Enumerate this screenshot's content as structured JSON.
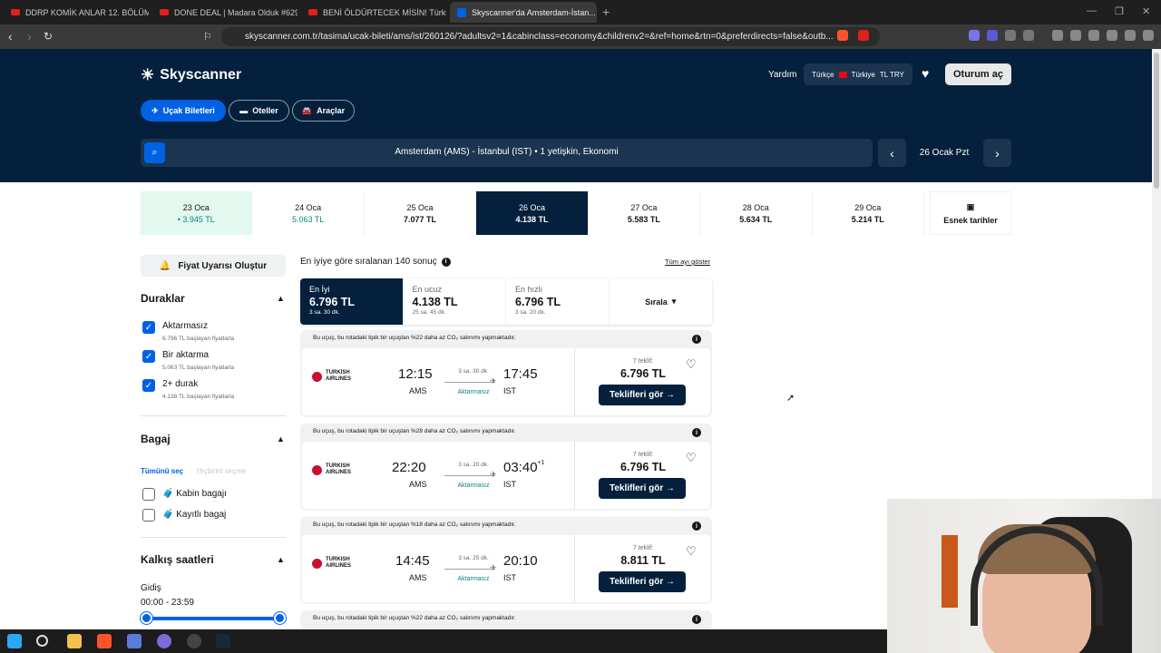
{
  "browser": {
    "tabs": [
      {
        "title": "DDRP KOMİK ANLAR 12. BÖLÜM VE..."
      },
      {
        "title": "DONE DEAL | Madara Olduk #629 - Y..."
      },
      {
        "title": "BENİ ÖLDÜRTECEK MİSİN! Türkiye'd..."
      },
      {
        "title": "Skyscanner'da Amsterdam-İstan..."
      }
    ],
    "url": "skyscanner.com.tr/tasima/ucak-bileti/ams/ist/260126/?adultsv2=1&cabinclass=economy&childrenv2=&ref=home&rtn=0&preferdirects=false&outb..."
  },
  "header": {
    "brand": "Skyscanner",
    "help": "Yardım",
    "locale": {
      "language": "Türkçe",
      "country": "Türkiye",
      "currency": "TL TRY"
    },
    "login": "Oturum aç",
    "categories": [
      {
        "label": "Uçak Biletleri",
        "icon": "plane-icon"
      },
      {
        "label": "Oteller",
        "icon": "bed-icon"
      },
      {
        "label": "Araçlar",
        "icon": "car-icon"
      }
    ],
    "search_summary": "Amsterdam (AMS) - İstanbul (IST)  •  1 yetişkin, Ekonomi",
    "selected_date": "26 Ocak Pzt"
  },
  "date_strip": [
    {
      "date": "23 Oca",
      "price": "• 3.945 TL",
      "state": "cheap"
    },
    {
      "date": "24 Oca",
      "price": "5.063 TL",
      "state": "green"
    },
    {
      "date": "25 Oca",
      "price": "7.077 TL",
      "state": "normal"
    },
    {
      "date": "26 Oca",
      "price": "4.138 TL",
      "state": "selected"
    },
    {
      "date": "27 Oca",
      "price": "5.583 TL",
      "state": "normal"
    },
    {
      "date": "28 Oca",
      "price": "5.634 TL",
      "state": "normal"
    },
    {
      "date": "29 Oca",
      "price": "5.214 TL",
      "state": "normal"
    }
  ],
  "flex_dates": "Esnek tarihler",
  "filters": {
    "price_alert": "Fiyat Uyarısı Oluştur",
    "stops_title": "Duraklar",
    "stops": [
      {
        "label": "Aktarmasız",
        "sub": "6.796 TL başlayan fiyatlarla"
      },
      {
        "label": "Bir aktarma",
        "sub": "5.063 TL başlayan fiyatlarla"
      },
      {
        "label": "2+ durak",
        "sub": "4.138 TL başlayan fiyatlarla"
      }
    ],
    "baggage_title": "Bagaj",
    "select_all": "Tümünü seç",
    "select_none": "Hiçbirini seçme",
    "baggage": [
      {
        "label": "Kabin bagajı"
      },
      {
        "label": "Kayıtlı bagaj"
      }
    ],
    "departure_title": "Kalkış saatleri",
    "outbound_label": "Gidiş",
    "outbound_range": "00:00 - 23:59"
  },
  "results": {
    "count_text": "En iyiye göre sıralanan 140 sonuç",
    "show_month": "Tüm ayı göster",
    "sort_tabs": [
      {
        "label": "En İyi",
        "price": "6.796 TL",
        "duration": "3 sa. 30 dk."
      },
      {
        "label": "En ucuz",
        "price": "4.138 TL",
        "duration": "25 sa. 45 dk."
      },
      {
        "label": "En hızlı",
        "price": "6.796 TL",
        "duration": "3 sa. 20 dk."
      }
    ],
    "sort_label": "Sırala",
    "flights": [
      {
        "eco_note": "Bu uçuş, bu rotadaki tipik bir uçuştan %22 daha az CO₂ salınımı yapmaktadır.",
        "airline": "TURKISH AIRLINES",
        "dep_time": "12:15",
        "dep_code": "AMS",
        "arr_time": "17:45",
        "arr_plus": "",
        "arr_code": "IST",
        "duration": "3 sa. 30 dk.",
        "stops": "Aktarmasız",
        "offers": "7 teklif:",
        "price": "6.796 TL",
        "cta": "Teklifleri gör →"
      },
      {
        "eco_note": "Bu uçuş, bu rotadaki tipik bir uçuştan %28 daha az CO₂ salınımı yapmaktadır.",
        "airline": "TURKISH AIRLINES",
        "dep_time": "22:20",
        "dep_code": "AMS",
        "arr_time": "03:40",
        "arr_plus": "+1",
        "arr_code": "IST",
        "duration": "3 sa. 20 dk.",
        "stops": "Aktarmasız",
        "offers": "7 teklif:",
        "price": "6.796 TL",
        "cta": "Teklifleri gör →"
      },
      {
        "eco_note": "Bu uçuş, bu rotadaki tipik bir uçuştan %18 daha az CO₂ salınımı yapmaktadır.",
        "airline": "TURKISH AIRLINES",
        "dep_time": "14:45",
        "dep_code": "AMS",
        "arr_time": "20:10",
        "arr_plus": "",
        "arr_code": "IST",
        "duration": "3 sa. 25 dk.",
        "stops": "Aktarmasız",
        "offers": "7 teklif:",
        "price": "8.811 TL",
        "cta": "Teklifleri gör →"
      },
      {
        "eco_note": "Bu uçuş, bu rotadaki tipik bir uçuştan %22 daha az CO₂ salınımı yapmaktadır."
      }
    ]
  },
  "colors": {
    "navy": "#05203c",
    "blue": "#0062e3",
    "green": "#0c838a"
  }
}
